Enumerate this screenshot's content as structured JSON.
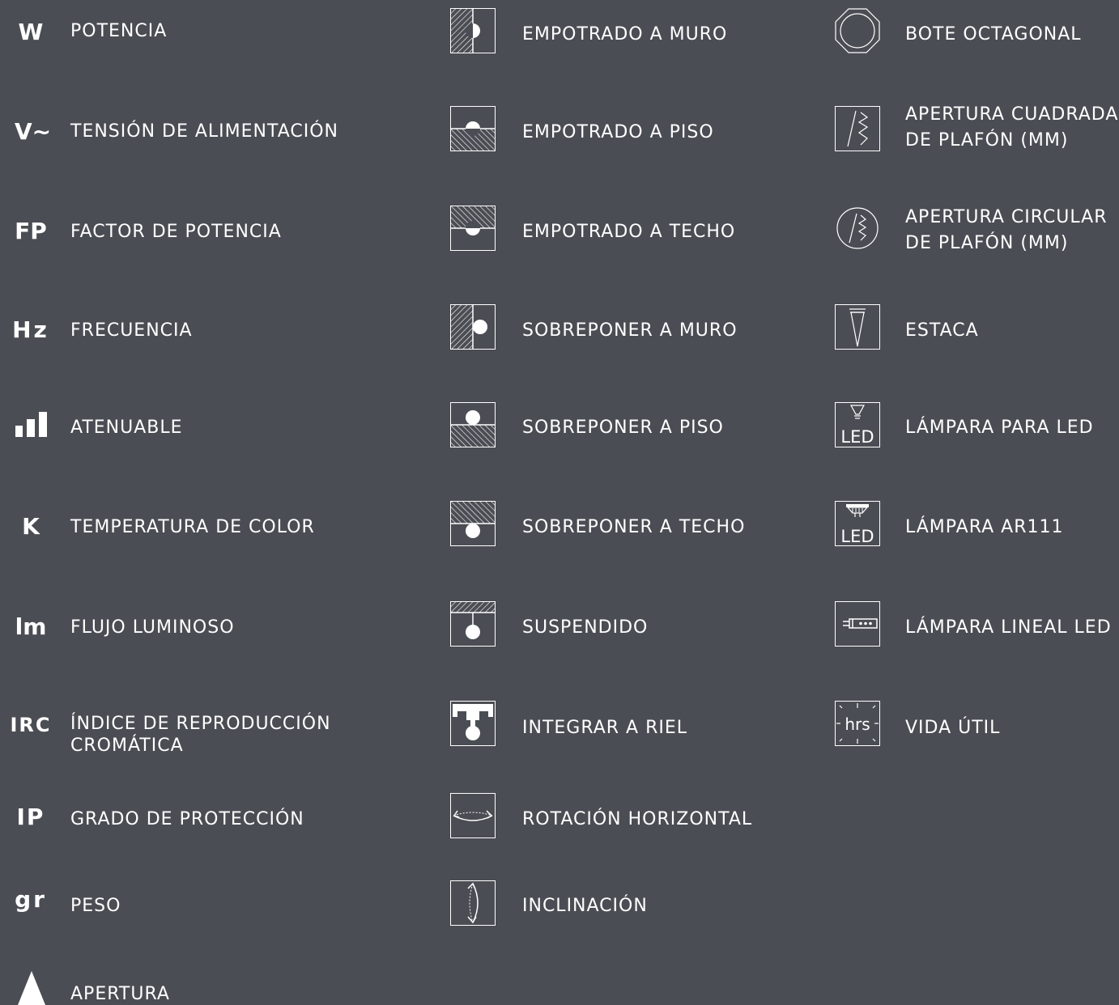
{
  "background_color": "#4b4d54",
  "foreground_color": "#ffffff",
  "column1": [
    {
      "symbol": "W",
      "label": "POTENCIA"
    },
    {
      "symbol": "V~",
      "label": "TENSIÓN DE ALIMENTACIÓN"
    },
    {
      "symbol": "FP",
      "label": "FACTOR DE POTENCIA"
    },
    {
      "symbol": "Hz",
      "label": "FRECUENCIA"
    },
    {
      "symbol": "",
      "icon": "signal-bars-icon",
      "label": "ATENUABLE"
    },
    {
      "symbol": "K",
      "label": "TEMPERATURA DE COLOR"
    },
    {
      "symbol": "lm",
      "label": "FLUJO LUMINOSO"
    },
    {
      "symbol": "IRC",
      "label_line1": "ÍNDICE DE REPRODUCCIÓN",
      "label_line2": "CROMÁTICA"
    },
    {
      "symbol": "IP",
      "label": "GRADO DE PROTECCIÓN"
    },
    {
      "symbol": "gr",
      "label": "PESO"
    },
    {
      "symbol": "",
      "icon": "triangle-icon",
      "label": "APERTURA"
    }
  ],
  "column2": [
    {
      "icon": "recessed-wall-icon",
      "label": "EMPOTRADO A MURO"
    },
    {
      "icon": "recessed-floor-icon",
      "label": "EMPOTRADO A PISO"
    },
    {
      "icon": "recessed-ceiling-icon",
      "label": "EMPOTRADO A TECHO"
    },
    {
      "icon": "surface-wall-icon",
      "label": "SOBREPONER A MURO"
    },
    {
      "icon": "surface-floor-icon",
      "label": "SOBREPONER A PISO"
    },
    {
      "icon": "surface-ceiling-icon",
      "label": "SOBREPONER A TECHO"
    },
    {
      "icon": "suspended-icon",
      "label": "SUSPENDIDO"
    },
    {
      "icon": "track-rail-icon",
      "label": "INTEGRAR A RIEL"
    },
    {
      "icon": "horizontal-rotation-icon",
      "label": "ROTACIÓN HORIZONTAL"
    },
    {
      "icon": "tilt-icon",
      "label": "INCLINACIÓN"
    }
  ],
  "column3": [
    {
      "icon": "octagonal-box-icon",
      "label": "BOTE OCTAGONAL"
    },
    {
      "icon": "square-cutout-icon",
      "label_line1": "APERTURA CUADRADA",
      "label_line2": "DE PLAFÓN (MM)"
    },
    {
      "icon": "circular-cutout-icon",
      "label_line1": "APERTURA CIRCULAR",
      "label_line2": "DE PLAFÓN (MM)"
    },
    {
      "icon": "stake-icon",
      "label": "ESTACA"
    },
    {
      "icon": "led-lamp-icon",
      "icon_text": "LED",
      "label": "LÁMPARA PARA LED"
    },
    {
      "icon": "ar111-lamp-icon",
      "icon_text": "LED",
      "label": "LÁMPARA AR111"
    },
    {
      "icon": "linear-led-icon",
      "label": "LÁMPARA LINEAL LED"
    },
    {
      "icon": "lifetime-clock-icon",
      "icon_text": "hrs",
      "label": "VIDA ÚTIL"
    }
  ]
}
